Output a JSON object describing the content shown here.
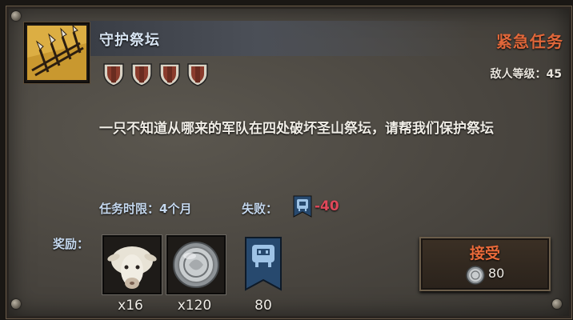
{
  "quest": {
    "title": "守护祭坛",
    "urgency": "紧急任务",
    "enemy_level": "敌人等级：45",
    "difficulty_shields": 4,
    "description": "一只不知道从哪来的军队在四处破坏圣山祭坛，请帮我们保护祭坛",
    "time_limit": "任务时限：4个月",
    "fail_label": "失败：",
    "fail_value": "-40"
  },
  "rewards": {
    "label": "奖励：",
    "items": [
      {
        "icon": "sheep-icon",
        "count": "x16"
      },
      {
        "icon": "silver-coin-icon",
        "count": "x120"
      },
      {
        "icon": "faction-banner-icon",
        "count": "80"
      }
    ]
  },
  "accept": {
    "label": "接受",
    "cost_icon": "silver-coin-icon",
    "cost": "80"
  },
  "colors": {
    "urgent": "#e0673a",
    "title": "#d7e4f2",
    "label_blue": "#c5d8ee",
    "fail_red": "#e0485a",
    "shield_red": "#8a3b2c"
  }
}
